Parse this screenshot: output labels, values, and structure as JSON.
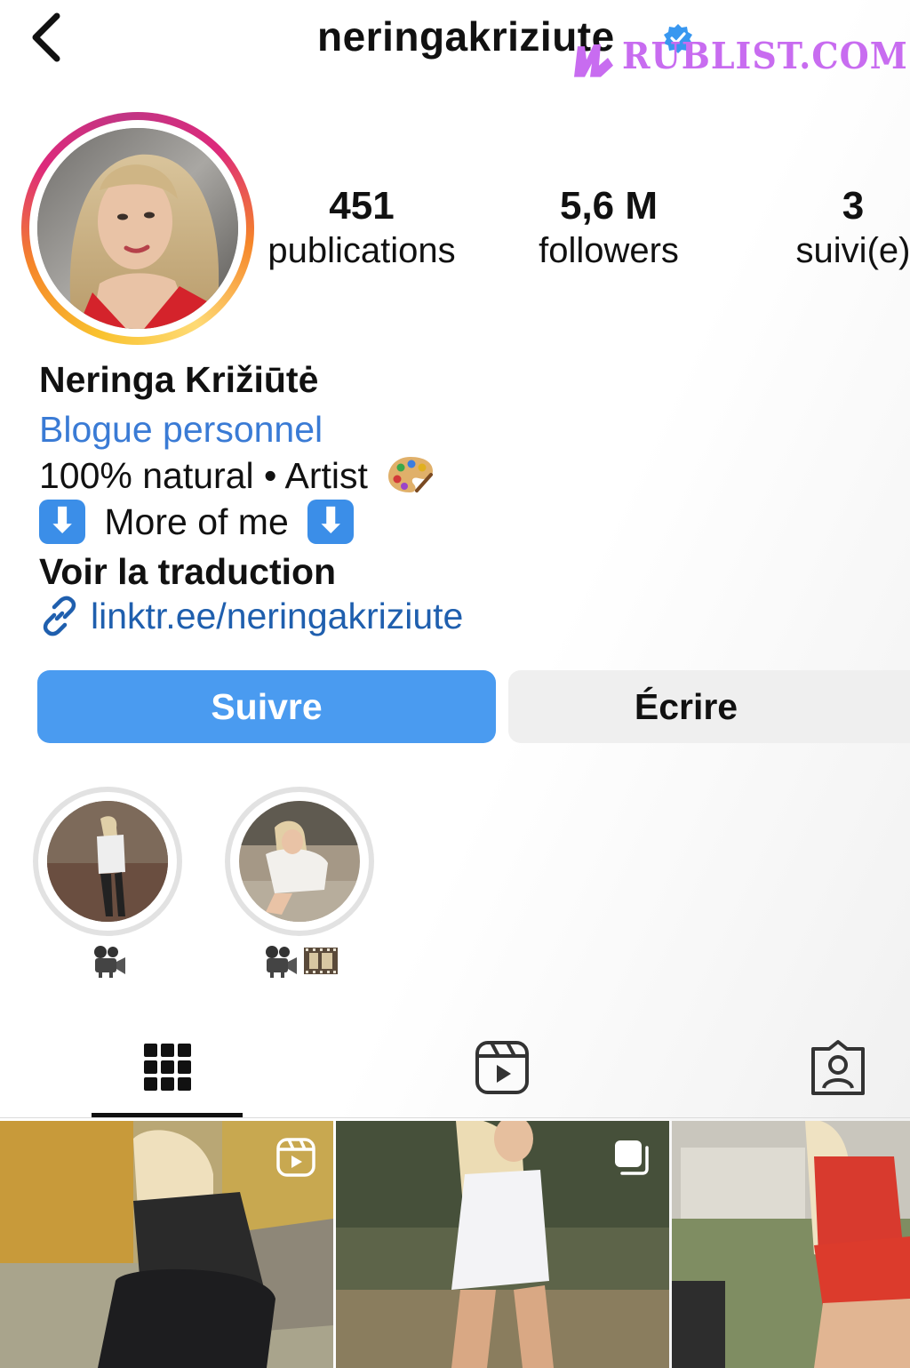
{
  "header": {
    "back_icon": "chevron-left-icon",
    "username": "neringakriziute",
    "verified_icon": "verified-badge-icon",
    "watermark": "RUBLIST.COM"
  },
  "profile": {
    "stats": {
      "posts_count": "451",
      "posts_label": "publications",
      "followers_count": "5,6 M",
      "followers_label": "followers",
      "following_count": "3",
      "following_label": "suivi(e)"
    },
    "full_name": "Neringa Križiūtė",
    "category": "Blogue personnel",
    "bio_line1": "100% natural • Artist",
    "bio_line1_emoji": "artist-palette-icon",
    "bio_line2_text": "More of me",
    "bio_line2_emoji": "down-arrow-box-icon",
    "arrow_glyph": "⬇",
    "translate_label": "Voir la traduction",
    "link_icon": "link-icon",
    "link": "linktr.ee/neringakriziute"
  },
  "actions": {
    "follow_label": "Suivre",
    "message_label": "Écrire"
  },
  "highlights": [
    {
      "label_icons": [
        "movie-camera-icon"
      ]
    },
    {
      "label_icons": [
        "movie-camera-icon",
        "film-frames-icon"
      ]
    }
  ],
  "tabs": [
    {
      "icon": "grid-icon",
      "active": true
    },
    {
      "icon": "reels-icon",
      "active": false
    },
    {
      "icon": "tagged-person-icon",
      "active": false
    }
  ],
  "posts": [
    {
      "type": "reel",
      "badge_icon": "reels-badge-icon"
    },
    {
      "type": "carousel",
      "badge_icon": "carousel-badge-icon"
    },
    {
      "type": "photo"
    }
  ],
  "colors": {
    "follow_button": "#4a9bf0",
    "link": "#1f5fae",
    "category": "#3a7bd5",
    "message_button": "#efefef",
    "verified": "#3897f0",
    "watermark": "#c86cf0"
  }
}
